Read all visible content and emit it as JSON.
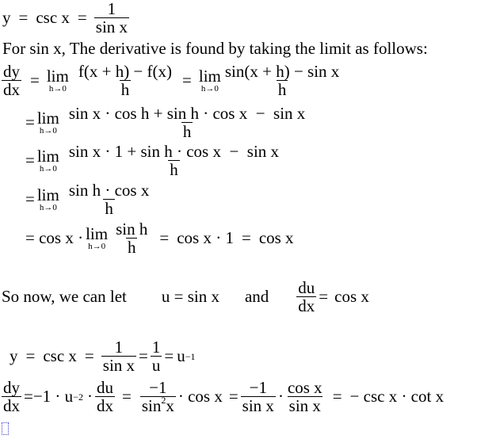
{
  "line1": {
    "lhs": "y",
    "eq1": "=",
    "mid": "csc x",
    "eq2": "=",
    "frac": {
      "num": "1",
      "den": "sin x"
    }
  },
  "intro_text": "For sin x, The derivative is found by taking the limit as follows:",
  "deriv_line": {
    "dy_dx": {
      "num": "dy",
      "den": "dx"
    },
    "eq1": "=",
    "lim": {
      "word": "lim",
      "sub": "h→0"
    },
    "frac1": {
      "num": "f(x + h) − f(x)",
      "den": "h"
    },
    "eq2": "=",
    "lim2": {
      "word": "lim",
      "sub": "h→0"
    },
    "frac2": {
      "num": "sin(x + h) − sin x",
      "den": "h"
    }
  },
  "step2": {
    "eq": "=",
    "lim": {
      "word": "lim",
      "sub": "h→0"
    },
    "frac": {
      "num": "sin x · cos h + sin h · cos x  −  sin x",
      "den": "h"
    }
  },
  "step3": {
    "eq": "=",
    "lim": {
      "word": "lim",
      "sub": "h→0"
    },
    "frac": {
      "num": "sin x · 1 + sin h · cos x  −  sin x",
      "den": "h"
    }
  },
  "step4": {
    "eq": "=",
    "lim": {
      "word": "lim",
      "sub": "h→0"
    },
    "frac": {
      "num": "sin h · cos x",
      "den": "h"
    }
  },
  "step5": {
    "pre": "= cos x ·",
    "lim": {
      "word": "lim",
      "sub": "h→0"
    },
    "frac": {
      "num": "sin h",
      "den": "h"
    },
    "post1": "=",
    "mid": "cos x · 1",
    "post2": "=",
    "result": "cos x"
  },
  "substitution": {
    "text": "So now, we can let",
    "u_def": "u = sin x",
    "and": "and",
    "du_dx": {
      "num": "du",
      "den": "dx"
    },
    "eq": "=",
    "result": "cos x"
  },
  "csc_line": {
    "lhs": "y",
    "eq1": "=",
    "mid": "csc x",
    "eq2": "=",
    "frac1": {
      "num": "1",
      "den": "sin x"
    },
    "eq3": "=",
    "frac2": {
      "num": "1",
      "den": "u"
    },
    "eq4": "=",
    "u_base": "u",
    "u_exp": "−1"
  },
  "chain_line": {
    "dy_dx": {
      "num": "dy",
      "den": "dx"
    },
    "eq1": "=",
    "term": "−1 · u",
    "exp": "−2",
    "dot": "·",
    "du_dx": {
      "num": "du",
      "den": "dx"
    },
    "eq2": "=",
    "frac1": {
      "num": "−1",
      "den_base": "sin",
      "den_exp": "2",
      "den_var": "x"
    },
    "mul1": "· cos x",
    "eq3": "=",
    "frac2": {
      "num": "−1",
      "den": "sin x"
    },
    "dot2": "·",
    "frac3": {
      "num": "cos x",
      "den": "sin x"
    },
    "eq4": "=",
    "result": "− csc x · cot x"
  }
}
